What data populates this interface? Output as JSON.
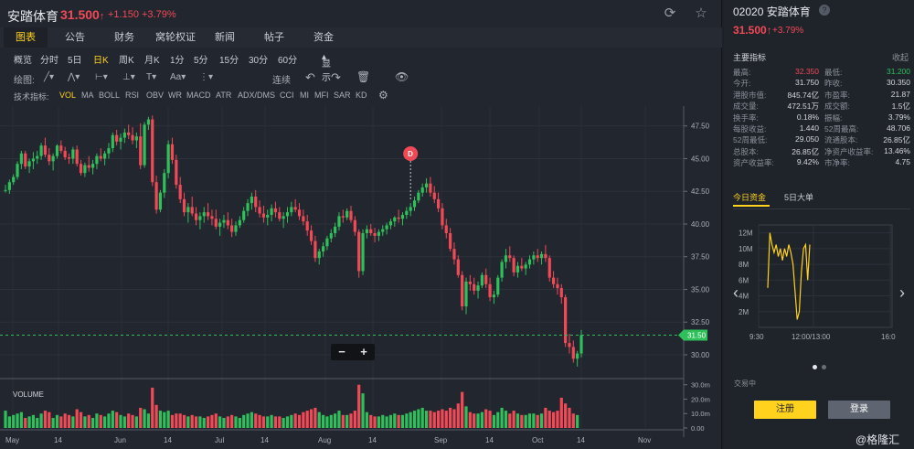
{
  "header": {
    "name": "安踏体育",
    "price": "31.500",
    "change": "+1.150 +3.79%",
    "refresh_icon": "refresh-icon",
    "star_icon": "star-icon"
  },
  "tabs": [
    "图表",
    "公告",
    "财务",
    "窝轮权证",
    "新闻",
    "帖子",
    "资金"
  ],
  "periods": [
    "概览",
    "分时",
    "5日",
    "日K",
    "周K",
    "月K",
    "1分",
    "5分",
    "15分",
    "30分",
    "60分",
    "显示"
  ],
  "drawbar": {
    "label": "绘图:",
    "continuous": "连续",
    "icons": [
      "line-tool-icon",
      "trend-tool-icon",
      "fib-tool-icon",
      "hline-tool-icon",
      "text-tool-icon",
      "measure-tool-icon",
      "undo-icon",
      "redo-icon",
      "trash-icon",
      "eye-icon"
    ]
  },
  "indicators": {
    "label": "技术指标:",
    "items": [
      "VOL",
      "MA",
      "BOLL",
      "RSI",
      "OBV",
      "WR",
      "MACD",
      "ATR",
      "ADX/DMS",
      "CCI",
      "MI",
      "MFI",
      "SAR",
      "KD"
    ]
  },
  "zoom": {
    "minus": "−",
    "plus": "+"
  },
  "chart_data": {
    "type": "candlestick",
    "y_ticks": [
      "47.50",
      "45.00",
      "42.50",
      "40.00",
      "37.50",
      "35.00",
      "32.50",
      "30.00"
    ],
    "ylim": [
      28.6,
      48.6
    ],
    "x_ticks": [
      "May",
      "14",
      "Jun",
      "14",
      "Jul",
      "14",
      "Aug",
      "14",
      "Sep",
      "14",
      "Oct",
      "14",
      "Nov"
    ],
    "current_price_label": "31.50",
    "current_price": 31.5,
    "dividend_marker": "D",
    "volume_label": "VOLUME",
    "volume_ticks": [
      "30.0m",
      "20.0m",
      "10.0m",
      "0.00"
    ],
    "volume_ylim": [
      0,
      33
    ],
    "candles": [
      [
        42.6,
        43.0,
        42.4,
        42.6
      ],
      [
        42.6,
        43.4,
        42.3,
        43.2
      ],
      [
        43.2,
        43.8,
        43.0,
        43.6
      ],
      [
        43.6,
        44.8,
        43.4,
        44.6
      ],
      [
        44.6,
        45.6,
        44.2,
        45.4
      ],
      [
        45.4,
        45.6,
        44.2,
        44.4
      ],
      [
        44.4,
        45.0,
        43.9,
        44.8
      ],
      [
        44.8,
        45.5,
        44.2,
        45.0
      ],
      [
        45.0,
        45.6,
        44.6,
        45.2
      ],
      [
        45.2,
        46.2,
        44.9,
        46.0
      ],
      [
        46.0,
        46.6,
        45.1,
        45.3
      ],
      [
        45.3,
        45.8,
        44.5,
        44.8
      ],
      [
        44.8,
        45.4,
        44.1,
        45.2
      ],
      [
        45.2,
        46.1,
        45.0,
        46.0
      ],
      [
        46.0,
        46.4,
        45.4,
        45.6
      ],
      [
        45.6,
        45.9,
        44.9,
        45.1
      ],
      [
        45.1,
        45.4,
        44.6,
        45.0
      ],
      [
        45.0,
        45.9,
        44.6,
        45.7
      ],
      [
        45.7,
        46.0,
        44.4,
        44.6
      ],
      [
        44.6,
        44.9,
        43.7,
        43.9
      ],
      [
        43.9,
        44.7,
        43.6,
        44.5
      ],
      [
        44.5,
        45.2,
        44.0,
        44.3
      ],
      [
        44.3,
        44.9,
        43.8,
        44.6
      ],
      [
        44.6,
        45.4,
        44.2,
        45.2
      ],
      [
        45.2,
        45.8,
        44.8,
        45.0
      ],
      [
        45.0,
        45.6,
        44.5,
        45.4
      ],
      [
        45.4,
        46.2,
        45.0,
        45.8
      ],
      [
        45.8,
        47.0,
        45.5,
        46.8
      ],
      [
        46.8,
        47.2,
        46.0,
        46.3
      ],
      [
        46.3,
        46.9,
        45.7,
        46.6
      ],
      [
        46.6,
        47.3,
        46.2,
        47.0
      ],
      [
        47.0,
        47.6,
        46.5,
        46.8
      ],
      [
        46.8,
        47.4,
        46.1,
        46.4
      ],
      [
        46.4,
        47.0,
        45.8,
        46.7
      ],
      [
        46.7,
        47.7,
        44.2,
        44.5
      ],
      [
        44.5,
        47.8,
        44.3,
        47.6
      ],
      [
        47.6,
        48.2,
        47.2,
        48.0
      ],
      [
        48.0,
        48.3,
        42.9,
        43.2
      ],
      [
        43.2,
        43.7,
        40.8,
        41.1
      ],
      [
        41.1,
        42.6,
        40.9,
        42.4
      ],
      [
        42.4,
        44.2,
        42.0,
        43.9
      ],
      [
        43.9,
        46.4,
        43.5,
        46.1
      ],
      [
        46.1,
        46.6,
        44.6,
        44.9
      ],
      [
        44.9,
        45.3,
        42.7,
        43.0
      ],
      [
        43.0,
        43.6,
        41.6,
        41.9
      ],
      [
        41.9,
        42.4,
        40.6,
        40.9
      ],
      [
        40.9,
        41.6,
        40.1,
        41.3
      ],
      [
        41.3,
        42.1,
        40.6,
        40.8
      ],
      [
        40.8,
        41.3,
        39.9,
        40.3
      ],
      [
        40.3,
        40.9,
        39.6,
        40.6
      ],
      [
        40.6,
        41.3,
        40.1,
        40.9
      ],
      [
        40.9,
        41.6,
        40.3,
        40.6
      ],
      [
        40.6,
        41.1,
        39.9,
        40.4
      ],
      [
        40.4,
        41.1,
        39.6,
        39.8
      ],
      [
        39.8,
        40.4,
        39.1,
        40.1
      ],
      [
        40.1,
        40.7,
        39.7,
        40.3
      ],
      [
        40.3,
        40.9,
        39.6,
        39.9
      ],
      [
        39.9,
        40.4,
        39.0,
        39.4
      ],
      [
        39.4,
        40.2,
        39.1,
        39.9
      ],
      [
        39.9,
        40.6,
        39.7,
        40.3
      ],
      [
        40.3,
        41.3,
        40.1,
        41.0
      ],
      [
        41.0,
        41.9,
        40.6,
        41.6
      ],
      [
        41.6,
        42.4,
        41.1,
        42.1
      ],
      [
        42.1,
        42.6,
        40.9,
        41.3
      ],
      [
        41.3,
        41.8,
        40.5,
        40.8
      ],
      [
        40.8,
        41.4,
        40.1,
        40.5
      ],
      [
        40.5,
        41.1,
        39.9,
        40.7
      ],
      [
        40.7,
        41.5,
        40.2,
        41.2
      ],
      [
        41.2,
        41.7,
        40.5,
        40.9
      ],
      [
        40.9,
        41.3,
        40.2,
        40.4
      ],
      [
        40.4,
        40.9,
        39.7,
        40.6
      ],
      [
        40.6,
        41.3,
        40.1,
        40.9
      ],
      [
        40.9,
        41.7,
        40.6,
        41.3
      ],
      [
        41.3,
        41.9,
        40.9,
        41.1
      ],
      [
        41.1,
        41.6,
        40.3,
        40.6
      ],
      [
        40.6,
        41.1,
        39.9,
        40.2
      ],
      [
        40.2,
        40.7,
        39.1,
        39.5
      ],
      [
        39.5,
        39.9,
        38.4,
        38.7
      ],
      [
        38.7,
        39.1,
        37.1,
        37.4
      ],
      [
        37.4,
        38.1,
        36.9,
        37.9
      ],
      [
        37.9,
        38.6,
        37.5,
        38.3
      ],
      [
        38.3,
        39.1,
        38.0,
        38.9
      ],
      [
        38.9,
        39.6,
        38.6,
        39.3
      ],
      [
        39.3,
        40.1,
        39.0,
        39.8
      ],
      [
        39.8,
        40.9,
        39.5,
        40.6
      ],
      [
        40.6,
        41.1,
        40.1,
        40.5
      ],
      [
        40.5,
        41.2,
        40.3,
        41.0
      ],
      [
        41.0,
        41.4,
        40.1,
        40.3
      ],
      [
        40.3,
        40.6,
        39.1,
        39.4
      ],
      [
        39.4,
        39.6,
        35.9,
        36.4
      ],
      [
        36.4,
        39.6,
        36.1,
        39.3
      ],
      [
        39.3,
        39.9,
        38.9,
        39.6
      ],
      [
        39.6,
        40.0,
        39.1,
        39.3
      ],
      [
        39.3,
        39.7,
        38.6,
        39.1
      ],
      [
        39.1,
        39.6,
        38.7,
        39.4
      ],
      [
        39.4,
        39.9,
        39.1,
        39.6
      ],
      [
        39.6,
        40.1,
        39.2,
        39.9
      ],
      [
        39.9,
        40.4,
        39.6,
        40.2
      ],
      [
        40.2,
        40.6,
        39.8,
        40.5
      ],
      [
        40.5,
        41.1,
        40.1,
        40.4
      ],
      [
        40.4,
        40.9,
        39.9,
        40.7
      ],
      [
        40.7,
        41.3,
        40.4,
        41.0
      ],
      [
        41.0,
        41.6,
        40.6,
        41.3
      ],
      [
        41.3,
        42.1,
        41.0,
        41.8
      ],
      [
        41.8,
        42.6,
        41.6,
        42.4
      ],
      [
        42.4,
        43.1,
        42.1,
        42.8
      ],
      [
        42.8,
        43.5,
        42.4,
        43.1
      ],
      [
        43.1,
        43.6,
        42.1,
        42.4
      ],
      [
        42.4,
        42.9,
        41.6,
        41.9
      ],
      [
        41.9,
        42.4,
        40.9,
        41.2
      ],
      [
        41.2,
        41.6,
        39.6,
        39.9
      ],
      [
        39.9,
        40.4,
        38.9,
        39.3
      ],
      [
        39.3,
        39.7,
        37.9,
        38.1
      ],
      [
        38.1,
        38.6,
        36.9,
        37.3
      ],
      [
        37.3,
        37.6,
        35.9,
        36.1
      ],
      [
        36.1,
        36.4,
        33.4,
        33.7
      ],
      [
        33.7,
        35.9,
        33.1,
        35.6
      ],
      [
        35.6,
        36.1,
        34.9,
        35.4
      ],
      [
        35.4,
        35.9,
        34.6,
        34.9
      ],
      [
        34.9,
        35.6,
        34.3,
        35.3
      ],
      [
        35.3,
        36.3,
        35.1,
        36.1
      ],
      [
        36.1,
        36.6,
        35.1,
        35.4
      ],
      [
        35.4,
        35.9,
        34.1,
        34.4
      ],
      [
        34.4,
        34.9,
        33.9,
        34.6
      ],
      [
        34.6,
        36.1,
        34.4,
        35.9
      ],
      [
        35.9,
        37.3,
        35.6,
        37.1
      ],
      [
        37.1,
        38.1,
        36.6,
        37.6
      ],
      [
        37.6,
        38.3,
        37.1,
        37.4
      ],
      [
        37.4,
        37.6,
        36.0,
        36.3
      ],
      [
        36.3,
        37.1,
        35.9,
        36.8
      ],
      [
        36.8,
        37.4,
        36.4,
        36.6
      ],
      [
        36.6,
        37.1,
        36.1,
        36.9
      ],
      [
        36.9,
        37.6,
        36.6,
        37.3
      ],
      [
        37.3,
        37.9,
        36.9,
        37.6
      ],
      [
        37.6,
        38.1,
        37.1,
        37.4
      ],
      [
        37.4,
        37.9,
        36.9,
        37.7
      ],
      [
        37.7,
        38.4,
        37.1,
        37.4
      ],
      [
        37.4,
        37.6,
        35.6,
        35.9
      ],
      [
        35.9,
        36.4,
        35.1,
        35.4
      ],
      [
        35.4,
        35.9,
        34.6,
        35.1
      ],
      [
        35.1,
        35.4,
        33.9,
        34.4
      ],
      [
        34.4,
        34.6,
        30.6,
        30.9
      ],
      [
        30.9,
        31.6,
        30.1,
        30.6
      ],
      [
        30.6,
        31.1,
        29.4,
        29.7
      ],
      [
        29.7,
        30.3,
        29.1,
        30.1
      ],
      [
        30.1,
        31.9,
        29.8,
        31.5
      ]
    ],
    "volumes": [
      12,
      8,
      9,
      10,
      11,
      7,
      8,
      9,
      7,
      10,
      12,
      11,
      7,
      9,
      8,
      10,
      9,
      8,
      13,
      11,
      8,
      9,
      7,
      10,
      9,
      8,
      10,
      12,
      11,
      9,
      8,
      10,
      9,
      8,
      14,
      13,
      10,
      28,
      16,
      12,
      11,
      12,
      9,
      10,
      10,
      9,
      8,
      9,
      8,
      8,
      7,
      8,
      9,
      10,
      8,
      7,
      8,
      9,
      8,
      7,
      9,
      10,
      11,
      10,
      9,
      8,
      8,
      9,
      8,
      8,
      7,
      8,
      9,
      10,
      9,
      11,
      12,
      13,
      14,
      11,
      9,
      8,
      9,
      10,
      12,
      9,
      9,
      10,
      12,
      30,
      24,
      11,
      9,
      8,
      8,
      9,
      8,
      9,
      10,
      9,
      9,
      10,
      11,
      12,
      13,
      14,
      12,
      12,
      11,
      12,
      13,
      12,
      14,
      13,
      17,
      25,
      15,
      11,
      10,
      10,
      11,
      13,
      12,
      9,
      11,
      14,
      12,
      10,
      12,
      10,
      9,
      9,
      10,
      10,
      9,
      10,
      14,
      12,
      11,
      12,
      21,
      17,
      14,
      10,
      9
    ]
  },
  "right_panel": {
    "title": "02020 安踏体育",
    "help_icon": "?",
    "price": "31.500",
    "change": "+3.79%",
    "section_title": "主要指标",
    "collapse": "收起",
    "stats": [
      [
        "最高:",
        "32.350",
        "最低:",
        "31.200"
      ],
      [
        "今开:",
        "31.750",
        "昨收:",
        "30.350"
      ],
      [
        "港股市值:",
        "845.74亿",
        "市盈率:",
        "21.87"
      ],
      [
        "成交量:",
        "472.51万",
        "成交额:",
        "1.5亿"
      ],
      [
        "换手率:",
        "0.18%",
        "振幅:",
        "3.79%"
      ],
      [
        "每股收益:",
        "1.440",
        "52周最高:",
        "48.706"
      ],
      [
        "52周最低:",
        "29.050",
        "流通股本:",
        "26.85亿"
      ],
      [
        "总股本:",
        "26.85亿",
        "净资产收益率:",
        "13.46%"
      ],
      [
        "资产收益率:",
        "9.42%",
        "市净率:",
        "4.75"
      ]
    ],
    "flow_tabs": [
      "今日资金",
      "5日大单"
    ],
    "flow_chart": {
      "y_ticks": [
        "12M",
        "10M",
        "8M",
        "6M",
        "4M",
        "2M"
      ],
      "x_ticks": [
        "9:30",
        "12:00/13:00",
        "16:00"
      ],
      "ylim": [
        0,
        13
      ],
      "values": [
        5,
        12,
        10.5,
        9.5,
        10.5,
        9,
        10,
        8.5,
        10,
        9,
        10.5,
        9.5,
        8,
        4.5,
        1,
        2,
        7,
        10,
        10.5,
        6,
        10.5
      ]
    },
    "status": "交易中",
    "register_label": "注册",
    "login_label": "登录"
  },
  "watermark": "@格隆汇",
  "colors": {
    "up": "#2fc05b",
    "down": "#f24957",
    "accent": "#ffd21e",
    "flow_line": "#ffd21e"
  }
}
